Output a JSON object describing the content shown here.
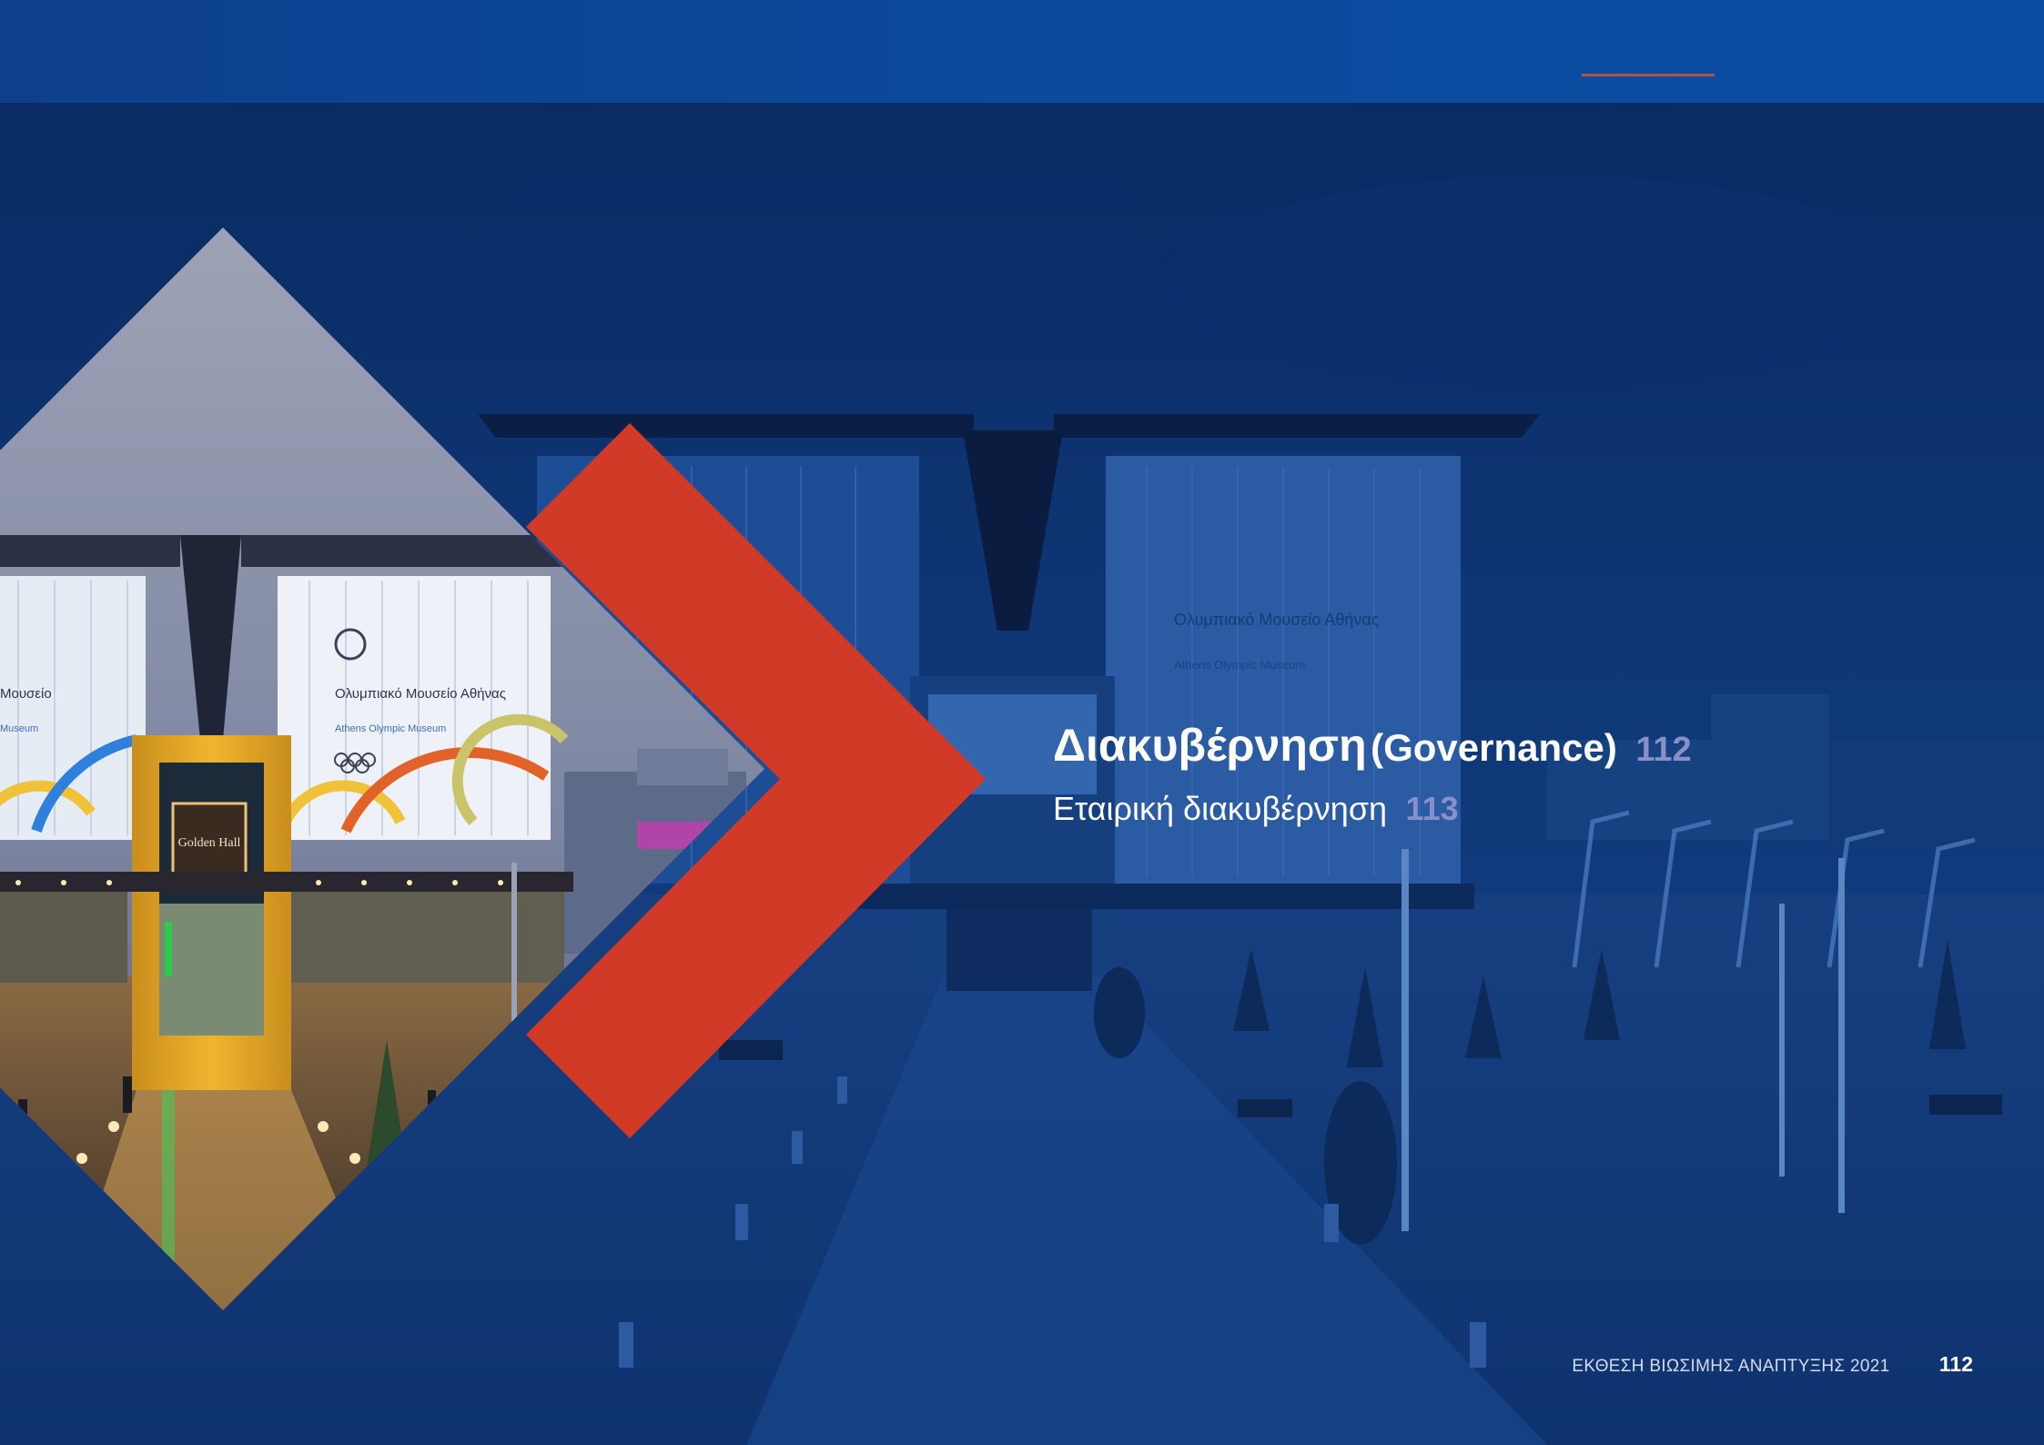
{
  "colors": {
    "brand_blue": "#0b4a9c",
    "accent_red": "#d23a28",
    "page_number": "#8a8fc8"
  },
  "section": {
    "title_greek": "Διακυβέρνηση",
    "title_english": "(Governance)",
    "title_page": "112",
    "items": [
      {
        "label": "Εταιρική διακυβέρνηση",
        "page": "113"
      }
    ]
  },
  "photo": {
    "facade_label_greek": "Ολυμπιακό Μουσείο Αθήνας",
    "facade_label_english": "Athens Olympic Museum",
    "facade_label_partial": "Μουσείο",
    "facade_label_partial_english": "Museum",
    "entrance_sign": "Golden Hall"
  },
  "footer": {
    "report_title": "ΕΚΘΕΣΗ ΒΙΩΣΙΜΗΣ ΑΝΑΠΤΥΞΗΣ 2021",
    "page_number": "112"
  }
}
